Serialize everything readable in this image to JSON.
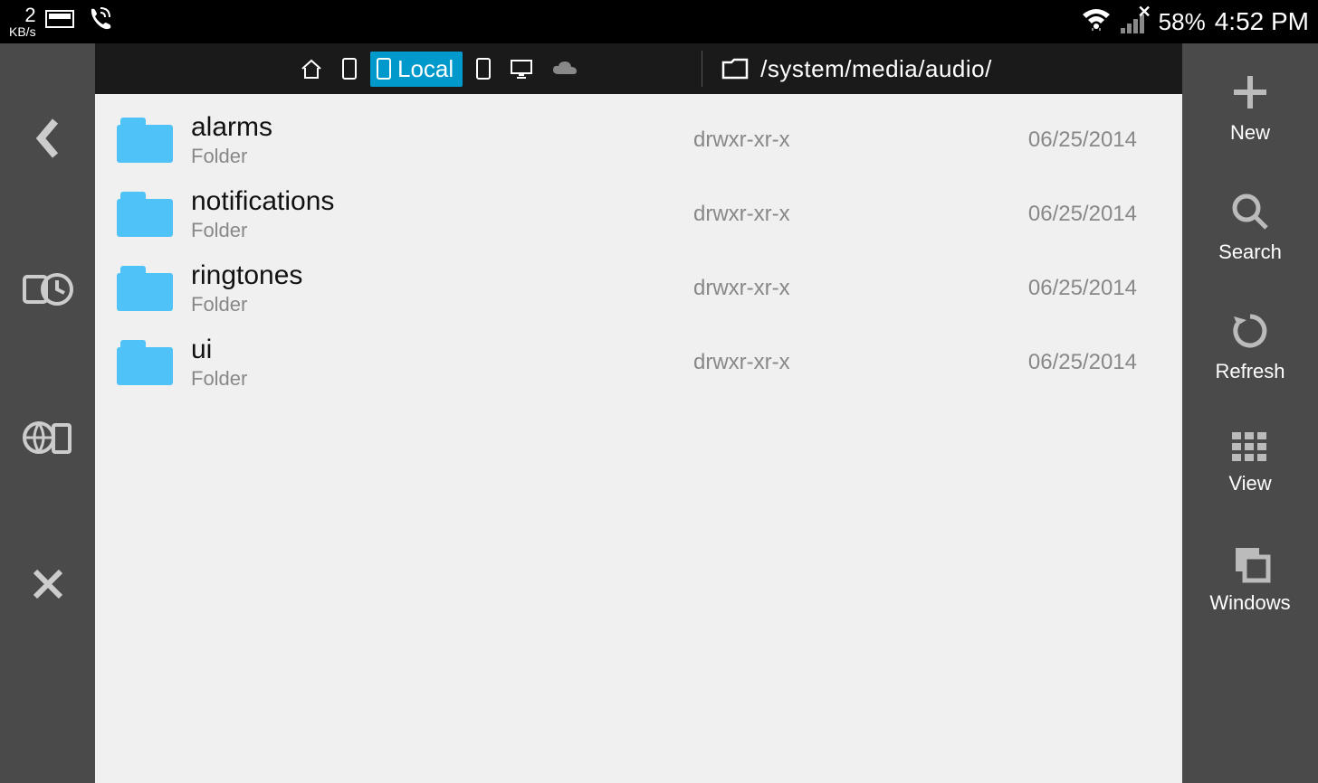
{
  "statusbar": {
    "net_speed_value": "2",
    "net_speed_unit": "KB/s",
    "battery_percent": "58%",
    "time": "4:52 PM"
  },
  "toolbar": {
    "local_label": "Local",
    "path": "/system/media/audio/"
  },
  "files": [
    {
      "name": "alarms",
      "type": "Folder",
      "perm": "drwxr-xr-x",
      "date": "06/25/2014"
    },
    {
      "name": "notifications",
      "type": "Folder",
      "perm": "drwxr-xr-x",
      "date": "06/25/2014"
    },
    {
      "name": "ringtones",
      "type": "Folder",
      "perm": "drwxr-xr-x",
      "date": "06/25/2014"
    },
    {
      "name": "ui",
      "type": "Folder",
      "perm": "drwxr-xr-x",
      "date": "06/25/2014"
    }
  ],
  "right_sidebar": {
    "new_label": "New",
    "search_label": "Search",
    "refresh_label": "Refresh",
    "view_label": "View",
    "windows_label": "Windows"
  }
}
